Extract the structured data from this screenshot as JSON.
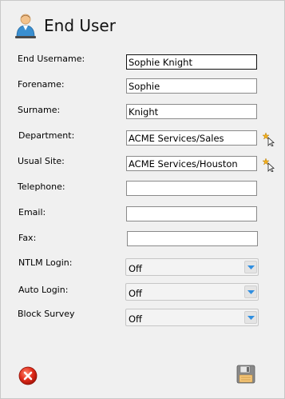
{
  "header": {
    "title": "End User",
    "icon": "user-icon"
  },
  "fields": {
    "username": {
      "label": "End Username:",
      "value": "Sophie Knight"
    },
    "forename": {
      "label": "Forename:",
      "value": "Sophie"
    },
    "surname": {
      "label": "Surname:",
      "value": "Knight"
    },
    "department": {
      "label": "Department:",
      "value": "ACME Services/Sales"
    },
    "usual_site": {
      "label": "Usual Site:",
      "value": "ACME Services/Houston"
    },
    "telephone": {
      "label": "Telephone:",
      "value": ""
    },
    "email": {
      "label": "Email:",
      "value": ""
    },
    "fax": {
      "label": "Fax:",
      "value": ""
    }
  },
  "selects": {
    "ntlm_login": {
      "label": "NTLM Login:",
      "value": "Off"
    },
    "auto_login": {
      "label": "Auto Login:",
      "value": "Off"
    },
    "block_survey": {
      "label": "Block Survey",
      "value": "Off"
    }
  },
  "footer": {
    "cancel_icon": "cancel-icon",
    "save_icon": "save-icon"
  },
  "colors": {
    "accent_blue": "#2f8ee0",
    "cancel_red": "#e02b1a",
    "background": "#f0f0f0"
  }
}
